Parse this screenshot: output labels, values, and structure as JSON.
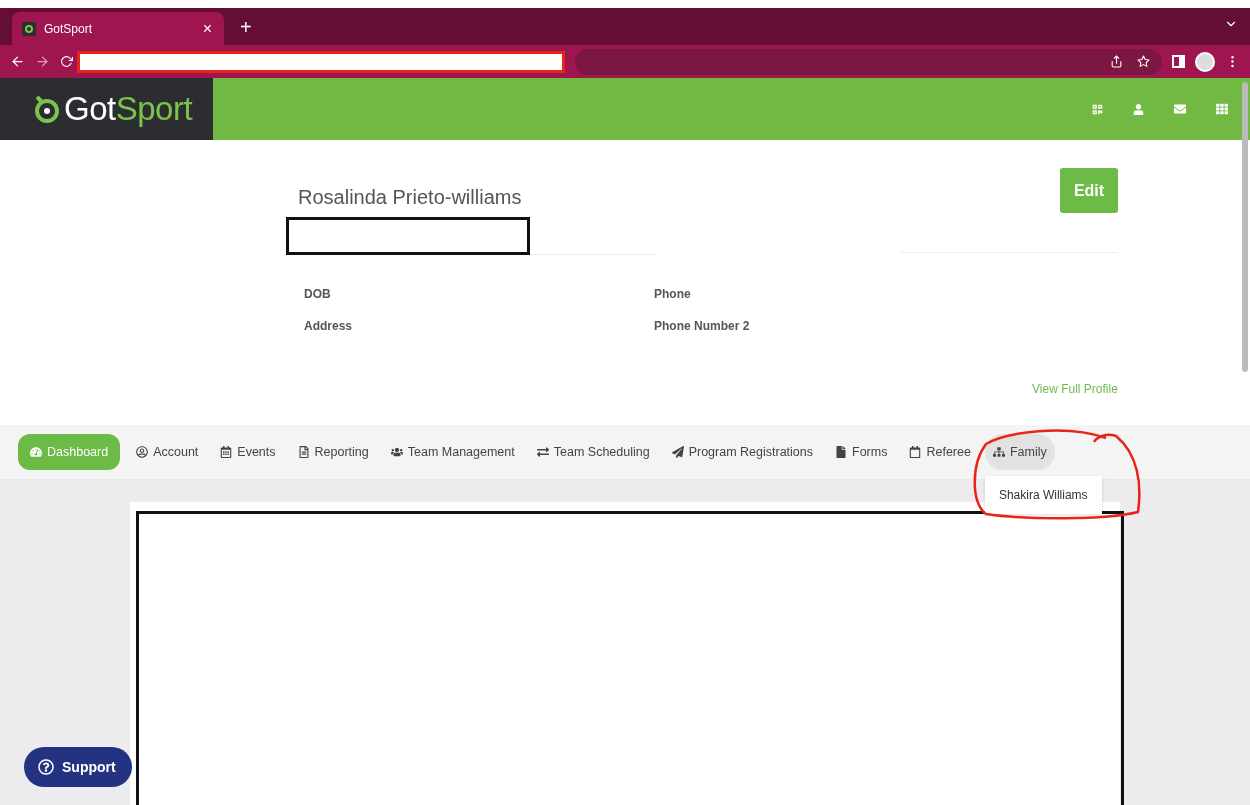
{
  "browser": {
    "tab_title": "GotSport",
    "tab_close": "×",
    "new_tab": "+"
  },
  "header": {
    "logo_part_1": "Got",
    "logo_part_2": "Sport"
  },
  "profile": {
    "name": "Rosalinda Prieto-williams",
    "edit_button": "Edit",
    "fields": [
      {
        "label": "DOB"
      },
      {
        "label": "Phone"
      },
      {
        "label": "Address"
      },
      {
        "label": "Phone Number 2"
      }
    ],
    "view_full_profile": "View Full Profile"
  },
  "nav": {
    "items": [
      {
        "label": "Dashboard",
        "selected": true
      },
      {
        "label": "Account",
        "selected": false
      },
      {
        "label": "Events",
        "selected": false
      },
      {
        "label": "Reporting",
        "selected": false
      },
      {
        "label": "Team Management",
        "selected": false
      },
      {
        "label": "Team Scheduling",
        "selected": false
      },
      {
        "label": "Program Registrations",
        "selected": false
      },
      {
        "label": "Forms",
        "selected": false
      },
      {
        "label": "Referee",
        "selected": false
      },
      {
        "label": "Family",
        "selected": false,
        "expanded": true,
        "menu": [
          "Shakira Williams"
        ]
      }
    ]
  },
  "support_button": "Support"
}
